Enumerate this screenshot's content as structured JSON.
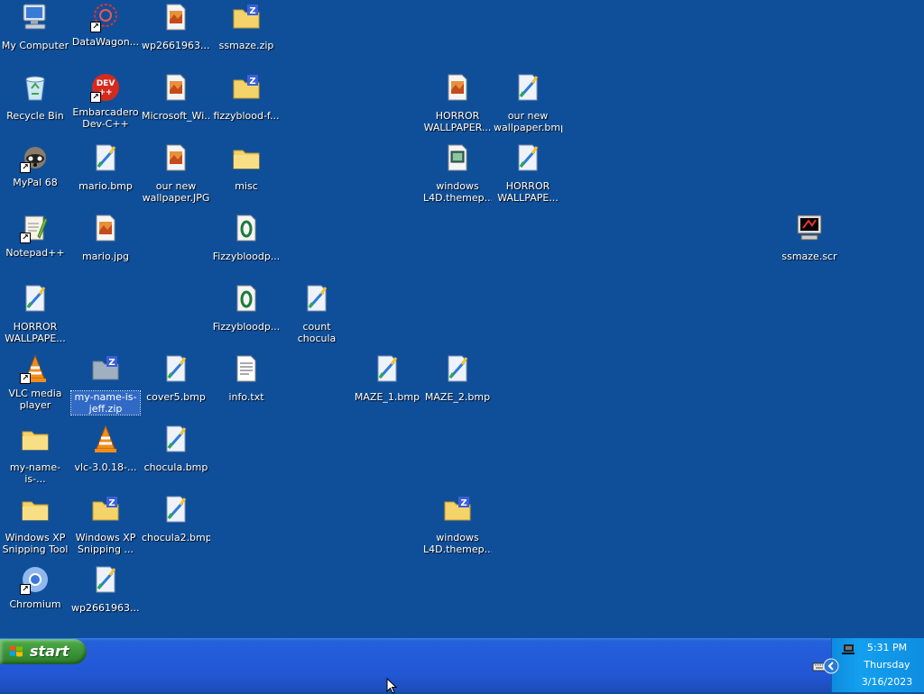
{
  "desktop": {
    "icons": [
      {
        "label": "My Computer"
      },
      {
        "label": "DataWagon..."
      },
      {
        "label": "wp2661963...."
      },
      {
        "label": "ssmaze.zip"
      },
      {
        "label": "Recycle Bin"
      },
      {
        "label": "Embarcadero Dev-C++"
      },
      {
        "label": "Microsoft_Wi..."
      },
      {
        "label": "fizzyblood-f..."
      },
      {
        "label": "HORROR WALLPAPER..."
      },
      {
        "label": "our new wallpaper.bmp"
      },
      {
        "label": "MyPal 68"
      },
      {
        "label": "mario.bmp"
      },
      {
        "label": "our new wallpaper.JPG"
      },
      {
        "label": "misc"
      },
      {
        "label": "windows L4D.themep..."
      },
      {
        "label": "HORROR WALLPAPE..."
      },
      {
        "label": "Notepad++"
      },
      {
        "label": "mario.jpg"
      },
      {
        "label": "Fizzybloodp..."
      },
      {
        "label": "ssmaze.scr"
      },
      {
        "label": "HORROR WALLPAPE..."
      },
      {
        "label": "Fizzybloodp..."
      },
      {
        "label": "count chocula smoking a ..."
      },
      {
        "label": "VLC media player"
      },
      {
        "label": "my-name-is-jeff.zip"
      },
      {
        "label": "cover5.bmp"
      },
      {
        "label": "info.txt"
      },
      {
        "label": "MAZE_1.bmp"
      },
      {
        "label": "MAZE_2.bmp"
      },
      {
        "label": "my-name-is-..."
      },
      {
        "label": "vlc-3.0.18-..."
      },
      {
        "label": "chocula.bmp"
      },
      {
        "label": "Windows XP Snipping Tool"
      },
      {
        "label": "Windows XP Snipping ..."
      },
      {
        "label": "chocula2.bmp"
      },
      {
        "label": "windows L4D.themep..."
      },
      {
        "label": "Chromium"
      },
      {
        "label": "wp2661963...."
      }
    ]
  },
  "taskbar": {
    "start_label": "start",
    "clock": {
      "time": "5:31 PM",
      "day": "Thursday",
      "date": "3/16/2023"
    }
  }
}
